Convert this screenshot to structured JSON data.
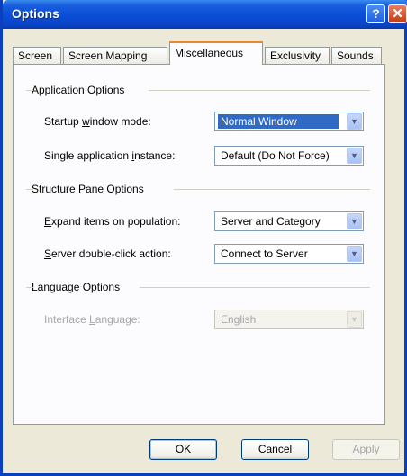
{
  "window": {
    "title": "Options"
  },
  "titlebar": {
    "help_glyph": "?",
    "close_glyph": "✕",
    "help_icon": "help-icon",
    "close_icon": "close-icon"
  },
  "tabs": [
    {
      "label": "Screen",
      "active": false
    },
    {
      "label": "Screen Mapping",
      "active": false
    },
    {
      "label": "Miscellaneous",
      "active": true
    },
    {
      "label": "Exclusivity",
      "active": false
    },
    {
      "label": "Sounds",
      "active": false
    }
  ],
  "groups": {
    "application": {
      "header": "Application Options",
      "startup": {
        "label_pre": "Startup ",
        "label_key": "w",
        "label_post": "indow mode:",
        "value": "Normal Window"
      },
      "single": {
        "label_pre": "Single application ",
        "label_key": "i",
        "label_post": "nstance:",
        "value": "Default (Do Not Force)"
      }
    },
    "structure": {
      "header": "Structure Pane Options",
      "expand": {
        "label_pre": "",
        "label_key": "E",
        "label_post": "xpand items on population:",
        "value": "Server and Category"
      },
      "dblclick": {
        "label_pre": "",
        "label_key": "S",
        "label_post": "erver double-click action:",
        "value": "Connect to Server"
      }
    },
    "language": {
      "header": "Language Options",
      "interface": {
        "label_pre": "Interface ",
        "label_key": "L",
        "label_post": "anguage:",
        "value": "English"
      }
    }
  },
  "combo_arrow": "▼",
  "buttons": {
    "ok": "OK",
    "cancel": "Cancel",
    "apply_key": "A",
    "apply_rest": "pply"
  },
  "colors": {
    "title_bar": "#0b4fd8",
    "dialog_bg": "#ece9d8",
    "selection": "#316ac5",
    "active_tab_accent": "#e68b2c"
  }
}
